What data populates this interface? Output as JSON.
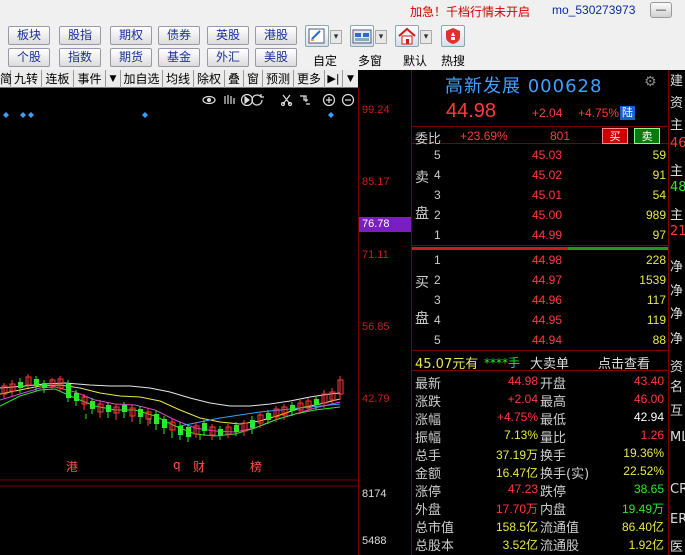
{
  "topbar": {
    "notice": "加急！千档行情未开启",
    "user_id": "mo_530273973",
    "minimize": "—"
  },
  "toolbar": {
    "row1": [
      "板块",
      "股指",
      "期权",
      "债券",
      "英股",
      "港股"
    ],
    "row2": [
      "个股",
      "指数",
      "期货",
      "基金",
      "外汇",
      "美股"
    ],
    "tools": [
      {
        "label": "自定",
        "icon": "edit-icon"
      },
      {
        "label": "多窗",
        "icon": "multi-window-icon"
      },
      {
        "label": "默认",
        "icon": "home-icon"
      },
      {
        "label": "热搜",
        "icon": "hot-search-icon"
      }
    ]
  },
  "chart": {
    "tabs": [
      "简",
      "九转",
      "连板",
      "事件",
      "加自选",
      "均线",
      "除权",
      "叠",
      "窗",
      "预测",
      "更多"
    ],
    "y_labels": [
      "99.24",
      "85.17",
      "71.11",
      "56.85",
      "42.79"
    ],
    "current_price_tag": "76.78",
    "vol_labels": [
      "8174",
      "5488"
    ],
    "events": [
      "港",
      "q",
      "财",
      "榜"
    ]
  },
  "quote": {
    "title": "高新发展 000628",
    "price": "44.98",
    "change": "+2.04",
    "change_pct": "+4.75%",
    "market": "陆",
    "weibi_label": "委比",
    "weibi": "+23.69%",
    "weicha": "801",
    "buy": "买",
    "sell": "卖",
    "ask_side": [
      "卖",
      "盘"
    ],
    "bid_side": [
      "买",
      "盘"
    ],
    "asks": [
      {
        "level": "5",
        "price": "45.03",
        "vol": "59"
      },
      {
        "level": "4",
        "price": "45.02",
        "vol": "91"
      },
      {
        "level": "3",
        "price": "45.01",
        "vol": "54"
      },
      {
        "level": "2",
        "price": "45.00",
        "vol": "989"
      },
      {
        "level": "1",
        "price": "44.99",
        "vol": "97"
      }
    ],
    "bids": [
      {
        "level": "1",
        "price": "44.98",
        "vol": "228"
      },
      {
        "level": "2",
        "price": "44.97",
        "vol": "1539"
      },
      {
        "level": "3",
        "price": "44.96",
        "vol": "117"
      },
      {
        "level": "4",
        "price": "44.95",
        "vol": "119"
      },
      {
        "level": "5",
        "price": "44.94",
        "vol": "88"
      }
    ],
    "big_order": {
      "price": "45.07元有",
      "stars": "****手",
      "title": "大卖单",
      "link": "点击查看"
    },
    "stats": [
      {
        "l1": "最新",
        "v1": "44.98",
        "c1": "#ff3a3a",
        "l2": "开盘",
        "v2": "43.40",
        "c2": "#ff3a3a"
      },
      {
        "l1": "涨跌",
        "v1": "+2.04",
        "c1": "#ff3a3a",
        "l2": "最高",
        "v2": "46.00",
        "c2": "#ff3a3a"
      },
      {
        "l1": "涨幅",
        "v1": "+4.75%",
        "c1": "#ff3a3a",
        "l2": "最低",
        "v2": "42.94",
        "c2": "#ffffff"
      },
      {
        "l1": "振幅",
        "v1": "7.13%",
        "c1": "#e8e84a",
        "l2": "量比",
        "v2": "1.26",
        "c2": "#ff3a3a"
      },
      {
        "l1": "总手",
        "v1": "37.19万",
        "c1": "#e8e84a",
        "l2": "换手",
        "v2": "19.36%",
        "c2": "#e8e84a"
      },
      {
        "l1": "金额",
        "v1": "16.47亿",
        "c1": "#e8e84a",
        "l2": "换手(实)",
        "v2": "22.52%",
        "c2": "#e8e84a"
      },
      {
        "l1": "涨停",
        "v1": "47.23",
        "c1": "#ff3a3a",
        "l2": "跌停",
        "v2": "38.65",
        "c2": "#2ee82e"
      },
      {
        "l1": "外盘",
        "v1": "17.70万",
        "c1": "#ff3a3a",
        "l2": "内盘",
        "v2": "19.49万",
        "c2": "#2ee82e"
      },
      {
        "l1": "总市值",
        "v1": "158.5亿",
        "c1": "#e8e84a",
        "l2": "流通值",
        "v2": "86.40亿",
        "c2": "#e8e84a"
      },
      {
        "l1": "总股本",
        "v1": "3.52亿",
        "c1": "#e8e84a",
        "l2": "流通股",
        "v2": "1.92亿",
        "c2": "#e8e84a"
      }
    ]
  },
  "edge": {
    "items": [
      {
        "t": "建",
        "c": "#ddd"
      },
      {
        "t": "资",
        "c": "#ddd"
      },
      {
        "t": "主",
        "c": "#ddd"
      },
      {
        "t": "46",
        "c": "#ff3a3a"
      },
      {
        "t": "主",
        "c": "#ddd"
      },
      {
        "t": "48",
        "c": "#2ee82e"
      },
      {
        "t": "主",
        "c": "#ddd"
      },
      {
        "t": "21",
        "c": "#ff3a3a"
      },
      {
        "t": "净",
        "c": "#ddd"
      },
      {
        "t": "净",
        "c": "#ddd"
      },
      {
        "t": "净",
        "c": "#ddd"
      },
      {
        "t": "净",
        "c": "#ddd"
      },
      {
        "t": "资",
        "c": "#ddd"
      },
      {
        "t": "名",
        "c": "#ddd"
      },
      {
        "t": "互",
        "c": "#ddd"
      },
      {
        "t": "ML",
        "c": "#ddd"
      },
      {
        "t": "CR",
        "c": "#ddd"
      },
      {
        "t": "ER",
        "c": "#ddd"
      },
      {
        "t": "医",
        "c": "#ddd"
      }
    ]
  },
  "colors": {
    "up": "#ff3a3a",
    "down": "#2ee82e",
    "volume": "#e8e84a",
    "accent_blue": "#3ea0ff"
  }
}
